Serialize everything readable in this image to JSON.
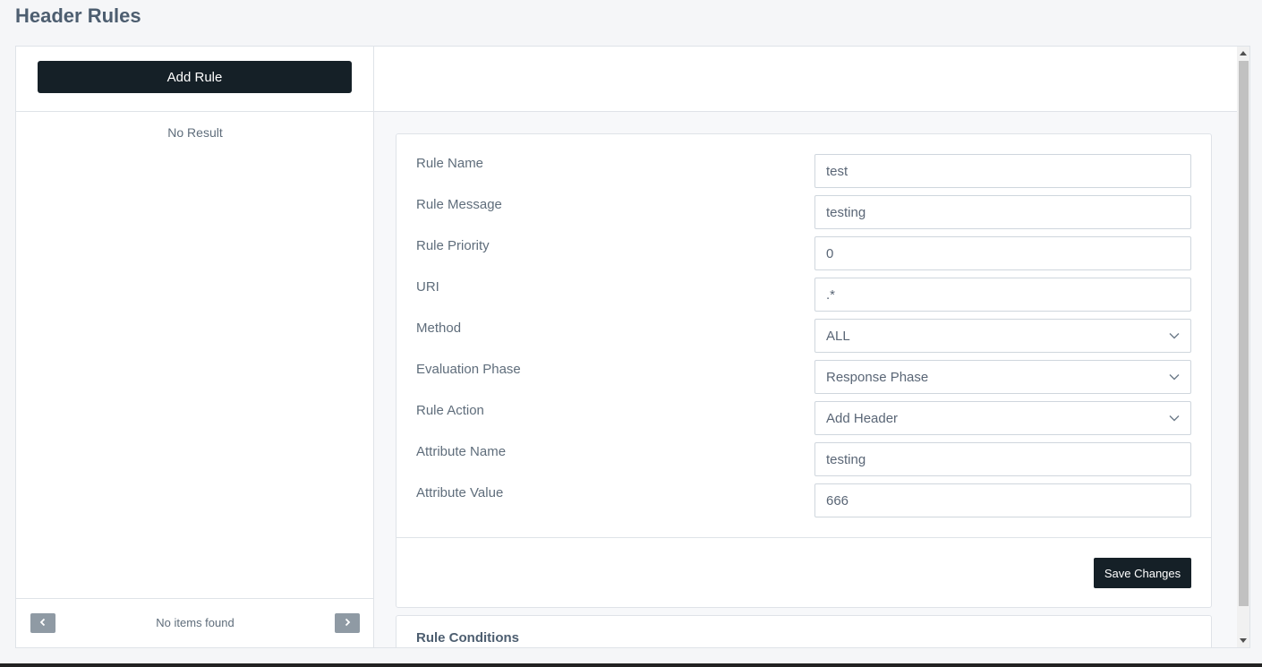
{
  "page": {
    "title": "Header Rules"
  },
  "left": {
    "add_rule_label": "Add Rule",
    "no_result": "No Result",
    "pager": {
      "status": "No items found",
      "prev_icon": "chevron-left-icon",
      "next_icon": "chevron-right-icon"
    }
  },
  "form": {
    "fields": [
      {
        "label": "Rule Name",
        "type": "input",
        "value": "test"
      },
      {
        "label": "Rule Message",
        "type": "input",
        "value": "testing"
      },
      {
        "label": "Rule Priority",
        "type": "input",
        "value": "0"
      },
      {
        "label": "URI",
        "type": "input",
        "value": ".*"
      },
      {
        "label": "Method",
        "type": "select",
        "value": "ALL"
      },
      {
        "label": "Evaluation Phase",
        "type": "select",
        "value": "Response Phase"
      },
      {
        "label": "Rule Action",
        "type": "select",
        "value": "Add Header"
      },
      {
        "label": "Attribute Name",
        "type": "input",
        "value": "testing"
      },
      {
        "label": "Attribute Value",
        "type": "input",
        "value": "666"
      }
    ],
    "save_label": "Save Changes"
  },
  "conditions": {
    "title": "Rule Conditions"
  },
  "colors": {
    "primary_button": "#152027",
    "pager_button": "#8f9aa4",
    "border": "#dfe3e8"
  }
}
